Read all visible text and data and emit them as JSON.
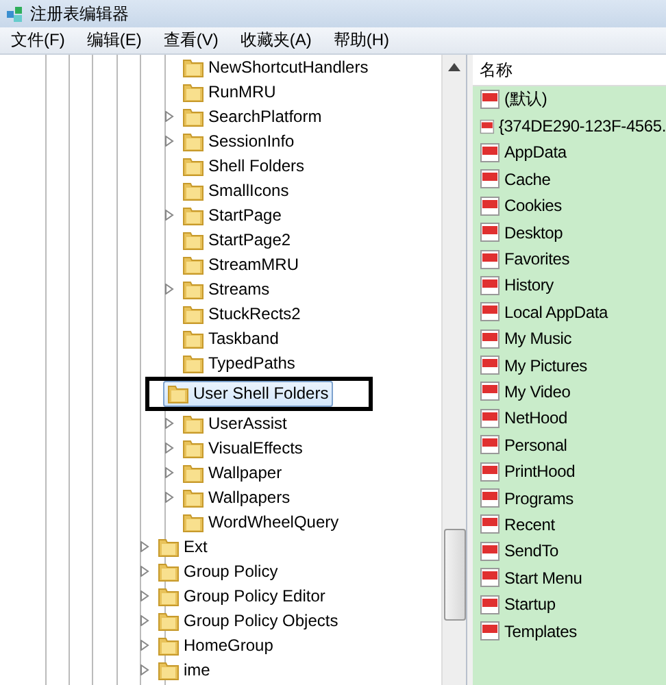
{
  "window": {
    "title": "注册表编辑器"
  },
  "menu": [
    "文件(F)",
    "编辑(E)",
    "查看(V)",
    "收藏夹(A)",
    "帮助(H)"
  ],
  "tree": {
    "items": [
      {
        "children": [
          {
            "label": "NewShortcutHandlers",
            "expandable": false,
            "selected": false
          },
          {
            "label": "RunMRU",
            "expandable": false,
            "selected": false
          },
          {
            "label": "SearchPlatform",
            "expandable": true,
            "selected": false
          },
          {
            "label": "SessionInfo",
            "expandable": true,
            "selected": false
          },
          {
            "label": "Shell Folders",
            "expandable": false,
            "selected": false
          },
          {
            "label": "SmallIcons",
            "expandable": false,
            "selected": false
          },
          {
            "label": "StartPage",
            "expandable": true,
            "selected": false
          },
          {
            "label": "StartPage2",
            "expandable": false,
            "selected": false
          },
          {
            "label": "StreamMRU",
            "expandable": false,
            "selected": false
          },
          {
            "label": "Streams",
            "expandable": true,
            "selected": false
          },
          {
            "label": "StuckRects2",
            "expandable": false,
            "selected": false
          },
          {
            "label": "Taskband",
            "expandable": false,
            "selected": false
          },
          {
            "label": "TypedPaths",
            "expandable": false,
            "selected": false
          },
          {
            "label": "User Shell Folders",
            "expandable": false,
            "selected": true
          },
          {
            "label": "UserAssist",
            "expandable": true,
            "selected": false
          },
          {
            "label": "VisualEffects",
            "expandable": true,
            "selected": false
          },
          {
            "label": "Wallpaper",
            "expandable": true,
            "selected": false
          },
          {
            "label": "Wallpapers",
            "expandable": true,
            "selected": false
          },
          {
            "label": "WordWheelQuery",
            "expandable": false,
            "selected": false
          }
        ]
      },
      {
        "label": "Ext",
        "expandable": true,
        "selected": false
      },
      {
        "label": "Group Policy",
        "expandable": true,
        "selected": false
      },
      {
        "label": "Group Policy Editor",
        "expandable": true,
        "selected": false
      },
      {
        "label": "Group Policy Objects",
        "expandable": true,
        "selected": false
      },
      {
        "label": "HomeGroup",
        "expandable": true,
        "selected": false
      },
      {
        "label": "ime",
        "expandable": true,
        "selected": false
      }
    ]
  },
  "values": {
    "columns": [
      "名称"
    ],
    "rows": [
      "(默认)",
      "{374DE290-123F-4565.",
      "AppData",
      "Cache",
      "Cookies",
      "Desktop",
      "Favorites",
      "History",
      "Local AppData",
      "My Music",
      "My Pictures",
      "My Video",
      "NetHood",
      "Personal",
      "PrintHood",
      "Programs",
      "Recent",
      "SendTo",
      "Start Menu",
      "Startup",
      "Templates"
    ]
  }
}
